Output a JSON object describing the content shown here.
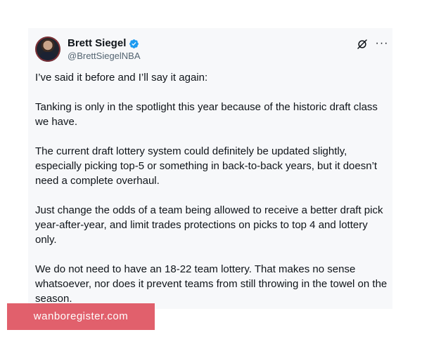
{
  "tweet": {
    "author": {
      "display_name": "Brett Siegel",
      "handle": "@BrettSiegelNBA",
      "verified": true
    },
    "icons": {
      "verified_color": "#1d9bf0",
      "grok": "grok-icon",
      "more": "more-options-icon",
      "more_glyph": "···"
    },
    "paragraphs": [
      "I’ve said it before and I’ll say it again:",
      "Tanking is only in the spotlight this year because of the historic draft class we have.",
      "The current draft lottery system could definitely be updated slightly, especially picking top-5 or something in back-to-back years, but it doesn’t need a complete overhaul.",
      "Just change the odds of a team being allowed to receive a better draft pick year-after-year, and limit trades protections on picks to top 4 and lottery only.",
      "We do not need to have an 18-22 team lottery. That makes no sense whatsoever, nor does it prevent teams from still throwing in the towel on the season."
    ]
  },
  "watermark": {
    "text": "wanboregister.com",
    "color": "#dd4a58"
  }
}
